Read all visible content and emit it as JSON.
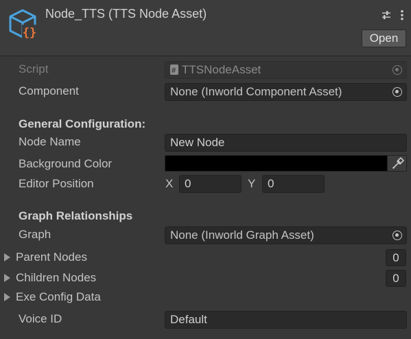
{
  "header": {
    "title": "Node_TTS (TTS Node Asset)",
    "open_label": "Open",
    "settings_icon": "sliders-icon",
    "menu_icon": "kebab-menu-icon",
    "accent_color": "#4aa3df",
    "brace_color": "#e8773a"
  },
  "script": {
    "label": "Script",
    "value": "TTSNodeAsset"
  },
  "component": {
    "label": "Component",
    "value": "None (Inworld Component Asset)"
  },
  "general": {
    "heading": "General Configuration:",
    "node_name_label": "Node Name",
    "node_name_value": "New Node",
    "bg_color_label": "Background Color",
    "bg_color_value": "#000000",
    "editor_position_label": "Editor Position",
    "x_label": "X",
    "x_value": "0",
    "y_label": "Y",
    "y_value": "0"
  },
  "graph": {
    "heading": "Graph Relationships",
    "graph_label": "Graph",
    "graph_value": "None (Inworld Graph Asset)",
    "parent_nodes_label": "Parent Nodes",
    "parent_nodes_count": "0",
    "children_nodes_label": "Children Nodes",
    "children_nodes_count": "0",
    "exe_config_label": "Exe Config Data",
    "voice_id_label": "Voice ID",
    "voice_id_value": "Default"
  }
}
